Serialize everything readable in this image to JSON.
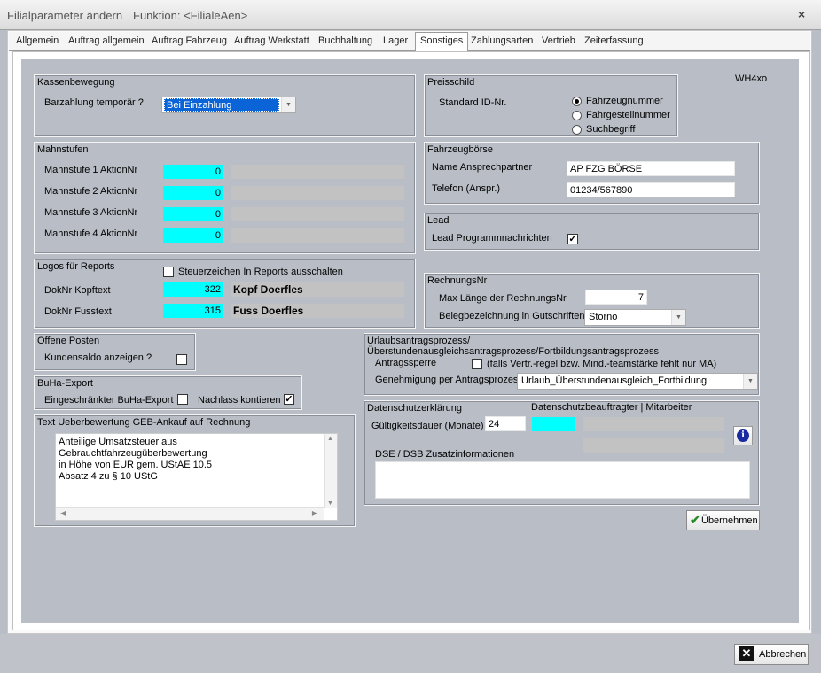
{
  "window": {
    "title": "Filialparameter ändern",
    "function_label": "Funktion: <FilialeAen>",
    "close_glyph": "×"
  },
  "tabs": [
    "Allgemein",
    "Auftrag allgemein",
    "Auftrag Fahrzeug",
    "Auftrag Werkstatt",
    "Buchhaltung",
    "Lager",
    "Sonstiges",
    "Zahlungsarten",
    "Vertrieb",
    "Zeiterfassung"
  ],
  "active_tab": "Sonstiges",
  "code_label": "WH4xo",
  "kassenbewegung": {
    "title": "Kassenbewegung",
    "label": "Barzahlung temporär ?",
    "value": "Bei Einzahlung"
  },
  "mahnstufen": {
    "title": "Mahnstufen",
    "rows": [
      {
        "label": "Mahnstufe 1 AktionNr",
        "value": "0"
      },
      {
        "label": "Mahnstufe 2 AktionNr",
        "value": "0"
      },
      {
        "label": "Mahnstufe 3 AktionNr",
        "value": "0"
      },
      {
        "label": "Mahnstufe 4 AktionNr",
        "value": "0"
      }
    ]
  },
  "logos": {
    "title": "Logos für Reports",
    "steuer_label": "Steuerzeichen In Reports ausschalten",
    "kopf_label": "DokNr Kopftext",
    "kopf_value": "322",
    "kopf_text": "Kopf Doerfles",
    "fuss_label": "DokNr Fusstext",
    "fuss_value": "315",
    "fuss_text": "Fuss Doerfles"
  },
  "offene_posten": {
    "title": "Offene Posten",
    "label": "Kundensaldo anzeigen ?"
  },
  "buha": {
    "title": "BuHa-Export",
    "label1": "Eingeschränkter BuHa-Export",
    "label2": "Nachlass kontieren",
    "checked2": "✓"
  },
  "text_ueber": {
    "title": "Text Ueberbewertung GEB-Ankauf auf Rechnung",
    "lines": [
      "Anteilige Umsatzsteuer aus",
      "Gebrauchtfahrzeugüberbewertung",
      "in Höhe von EUR gem. UStAE 10.5",
      "Absatz 4 zu § 10 UStG"
    ]
  },
  "preisschild": {
    "title": "Preisschild",
    "label": "Standard ID-Nr.",
    "options": [
      "Fahrzeugnummer",
      "Fahrgestellnummer",
      "Suchbegriff"
    ],
    "selected": "Fahrzeugnummer"
  },
  "fahrzeugboerse": {
    "title": "Fahrzeugbörse",
    "name_label": "Name Ansprechpartner",
    "name_value": "AP FZG BÖRSE",
    "tel_label": "Telefon (Anspr.)",
    "tel_value": "01234/567890"
  },
  "lead": {
    "title": "Lead",
    "label": "Lead Programmnachrichten",
    "checked": "✓"
  },
  "rechnungsnr": {
    "title": "RechnungsNr",
    "max_label": "Max Länge der RechnungsNr",
    "max_value": "7",
    "beleg_label": "Belegbezeichnung in Gutschriften",
    "beleg_value": "Storno"
  },
  "urlaub": {
    "title": "Urlaubsantragsprozess/Überstundenausgleichsantragsprozess/Fortbildungsantragsprozess",
    "sperre_label": "Antragssperre",
    "sperre_hint": "(falls Vertr.-regel bzw. Mind.-teamstärke fehlt nur MA)",
    "genehmigung_label": "Genehmigung per Antragsprozess",
    "genehmigung_value": "Urlaub_Überstundenausgleich_Fortbildung"
  },
  "datenschutz": {
    "title": "Datenschutzerklärung",
    "beauftragter_label": "Datenschutzbeauftragter | Mitarbeiter",
    "gueltig_label": "Gültigkeitsdauer (Monate)",
    "gueltig_value": "24",
    "dse_label": "DSE / DSB Zusatzinformationen"
  },
  "buttons": {
    "uebernehmen": "Übernehmen",
    "abbrechen": "Abbrechen"
  },
  "colors": {
    "panel_bg": "#b9bec6",
    "highlight_field": "#00ffff",
    "selection_blue": "#0a64d8"
  }
}
